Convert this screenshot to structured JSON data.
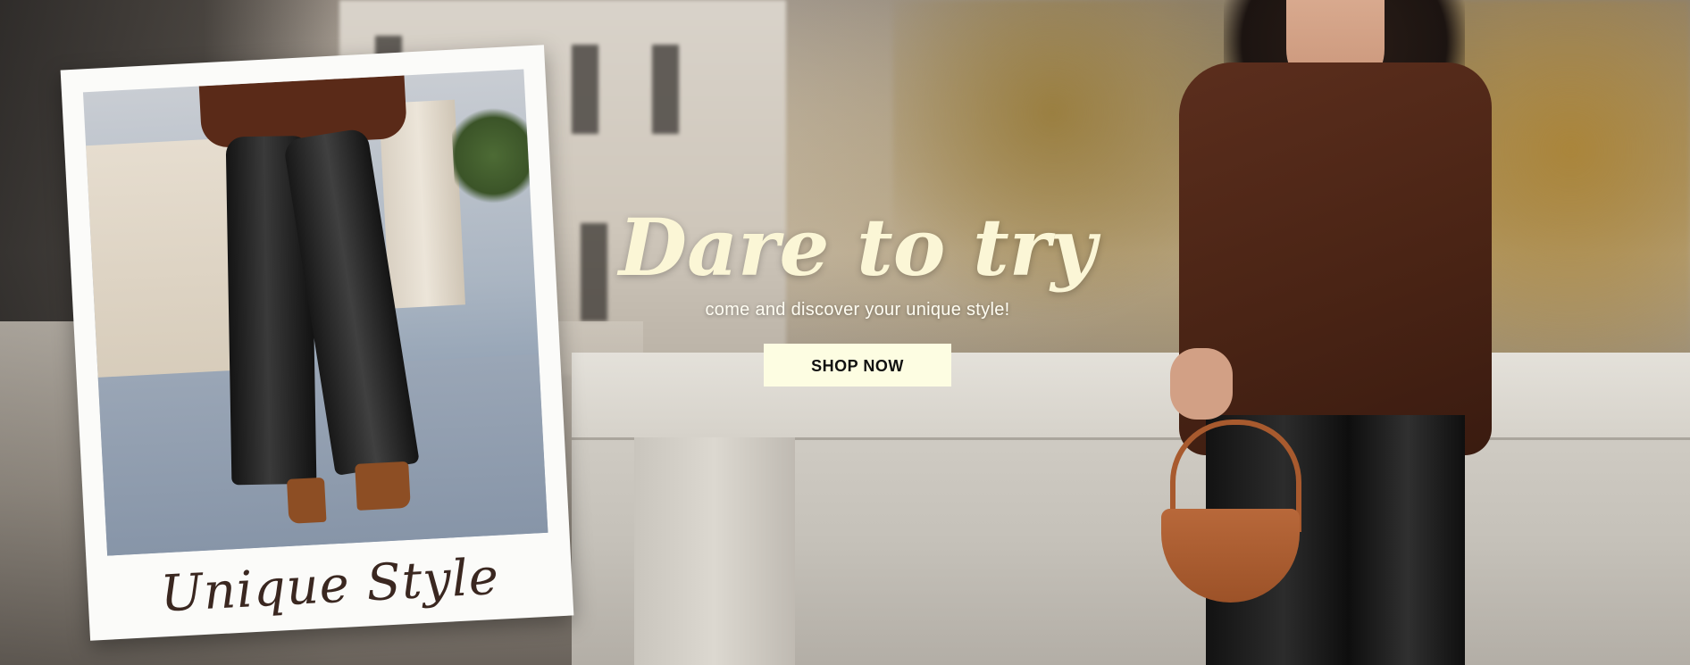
{
  "hero": {
    "title": "Dare to try",
    "subtitle": "come and discover your unique style!",
    "cta_label": "SHOP NOW"
  },
  "polaroid": {
    "caption": "Unique Style"
  },
  "colors": {
    "title": "#fbf6d6",
    "button_background": "#fdfde2",
    "button_text": "#111111",
    "caption": "#3a2720"
  }
}
